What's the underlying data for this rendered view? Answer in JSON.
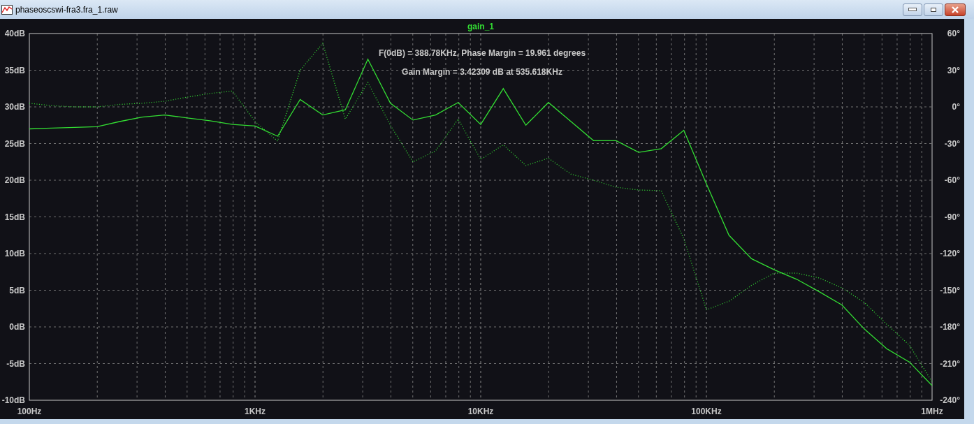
{
  "window": {
    "title": "phaseoscswi-fra3.fra_1.raw"
  },
  "plot": {
    "chart_data": {
      "type": "line",
      "title": "gain_1",
      "grid": true,
      "categories": [
        "100Hz",
        null,
        null,
        null,
        null,
        null,
        null,
        null,
        null,
        null,
        "1KHz",
        null,
        null,
        null,
        null,
        null,
        null,
        null,
        null,
        null,
        "10KHz",
        null,
        null,
        null,
        null,
        null,
        null,
        null,
        null,
        null,
        "100KHz",
        null,
        null,
        null,
        null,
        null,
        null,
        null,
        null,
        null,
        "1MHz"
      ],
      "ylim": [
        -10,
        40
      ],
      "yticks": [
        {
          "value": 40,
          "label": "40dB"
        },
        {
          "value": 35,
          "label": "35dB"
        },
        {
          "value": 30,
          "label": "30dB"
        },
        {
          "value": 25,
          "label": "25dB"
        },
        {
          "value": 20,
          "label": "20dB"
        },
        {
          "value": 15,
          "label": "15dB"
        },
        {
          "value": 10,
          "label": "10dB"
        },
        {
          "value": 5,
          "label": "5dB"
        },
        {
          "value": 0,
          "label": "0dB"
        },
        {
          "value": -5,
          "label": "-5dB"
        },
        {
          "value": -10,
          "label": "-10dB"
        }
      ],
      "y2lim": [
        -240,
        60
      ],
      "y2ticks": [
        {
          "value": 60,
          "label": "60°"
        },
        {
          "value": 30,
          "label": "30°"
        },
        {
          "value": 0,
          "label": "0°"
        },
        {
          "value": -30,
          "label": "-30°"
        },
        {
          "value": -60,
          "label": "-60°"
        },
        {
          "value": -90,
          "label": "-90°"
        },
        {
          "value": -120,
          "label": "-120°"
        },
        {
          "value": -150,
          "label": "-150°"
        },
        {
          "value": -180,
          "label": "-180°"
        },
        {
          "value": -210,
          "label": "-210°"
        },
        {
          "value": -240,
          "label": "-240°"
        }
      ],
      "series": [
        {
          "color": "#33dd33",
          "values": [
            27.0,
            27.1,
            27.2,
            27.3,
            28.0,
            28.6,
            28.9,
            28.5,
            28.1,
            27.6,
            27.4,
            26.0,
            31.0,
            28.9,
            29.6,
            36.5,
            30.5,
            28.2,
            28.9,
            30.6,
            27.6,
            32.5,
            27.5,
            30.6,
            28.0,
            25.4,
            25.4,
            23.8,
            24.3,
            26.8,
            19.5,
            12.5,
            9.3,
            7.8,
            6.5,
            4.8,
            3.0,
            -0.3,
            -3.0,
            -4.8,
            -8.0
          ]
        },
        {
          "color": "#33dd33",
          "axis": "y2",
          "line_style": "dotted",
          "values": [
            3,
            1,
            0,
            0,
            2,
            3,
            4.6,
            8,
            11,
            13,
            -12,
            -28,
            30,
            52,
            -10,
            20,
            -15,
            -45,
            -36,
            -10,
            -43,
            -31,
            -48,
            -42,
            -55,
            -60,
            -65.7,
            -68,
            -68.6,
            -108,
            -166,
            -159,
            -146,
            -136,
            -136,
            -140,
            -148,
            -160,
            -178,
            -195,
            -225
          ]
        }
      ],
      "annotations": [
        {
          "text": "F(0dB) = 388.78KHz, Phase Margin = 19.961 degrees"
        },
        {
          "text": "Gain Margin = 3.42309 dB at 535.618KHz"
        }
      ]
    }
  }
}
